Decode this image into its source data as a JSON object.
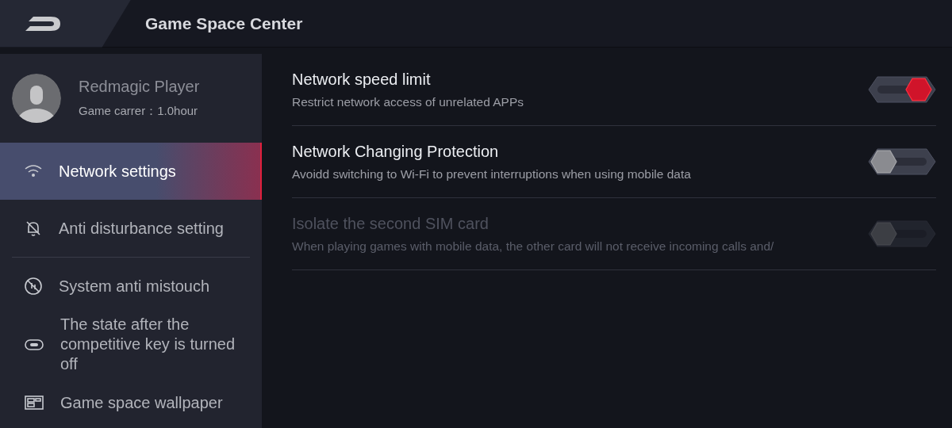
{
  "header": {
    "title": "Game Space Center"
  },
  "profile": {
    "name": "Redmagic Player",
    "subtitle": "Game carrer：1.0hour"
  },
  "sidebar": {
    "groups": [
      [
        {
          "label": "Network settings",
          "selected": true
        },
        {
          "label": "Anti disturbance setting",
          "selected": false
        }
      ],
      [
        {
          "label": "System anti mistouch",
          "selected": false
        },
        {
          "label": "The state after the competitive key is turned off",
          "selected": false
        },
        {
          "label": "Game space wallpaper",
          "selected": false
        }
      ]
    ]
  },
  "settings": [
    {
      "title": "Network speed limit",
      "subtitle": "Restrict network access of unrelated APPs",
      "on": true,
      "disabled": false
    },
    {
      "title": "Network Changing Protection",
      "subtitle": "Avoidd switching to Wi-Fi to prevent interruptions when using mobile data",
      "on": false,
      "disabled": false
    },
    {
      "title": "Isolate the second SIM card",
      "subtitle": "When playing games with mobile data, the other card will not receive incoming calls and/",
      "on": false,
      "disabled": true
    }
  ]
}
